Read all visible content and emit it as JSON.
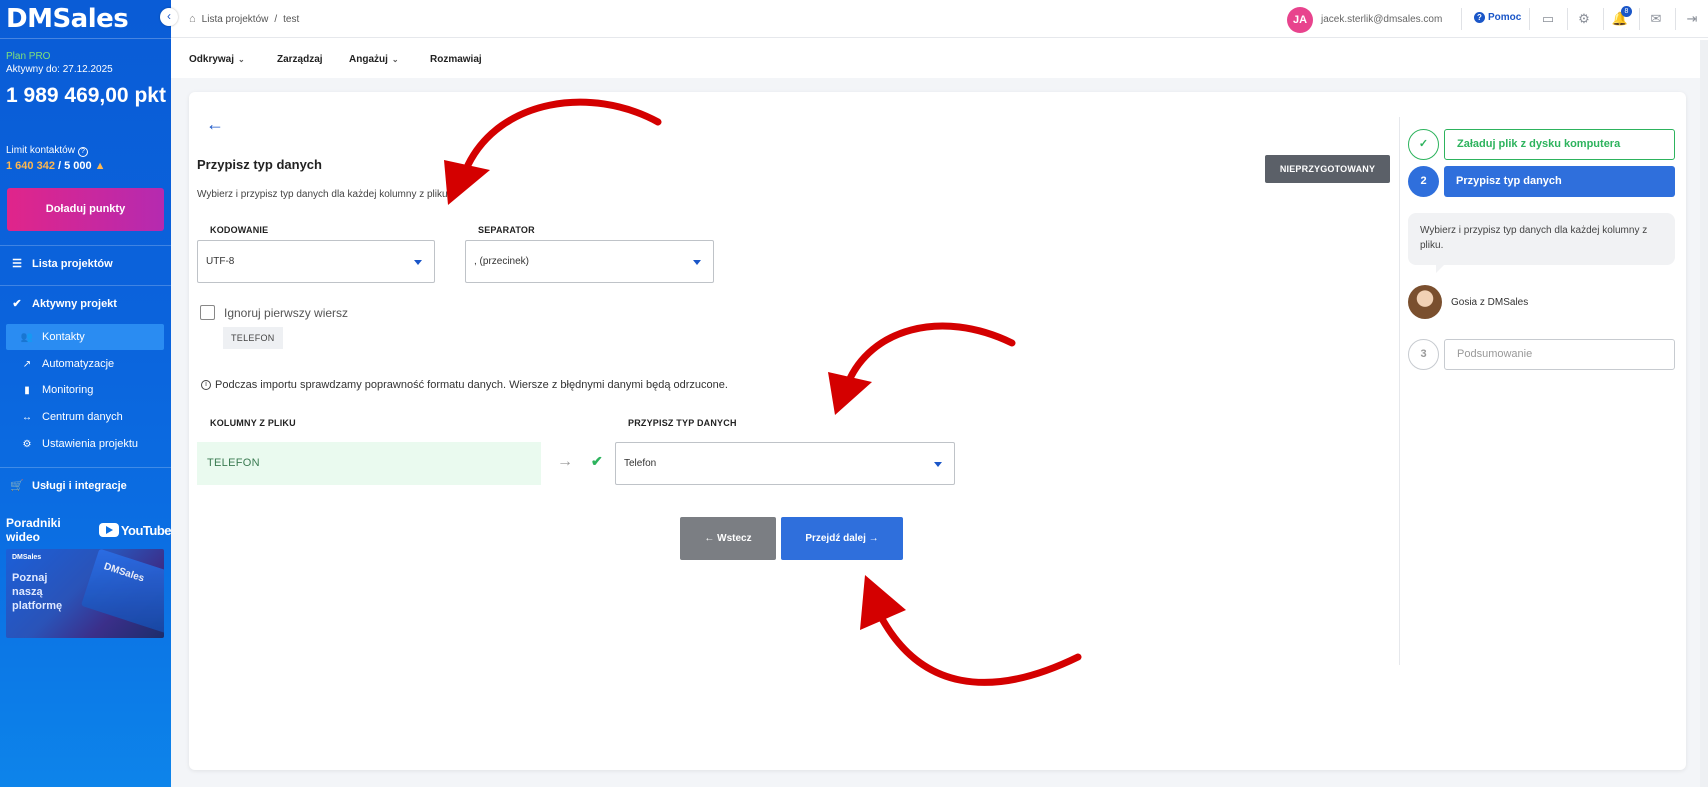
{
  "sidebar": {
    "logo": "DMSales",
    "collapse_icon": "chevron-left",
    "plan": "Plan PRO",
    "active_until": "Aktywny do: 27.12.2025",
    "points": "1 989 469,00 pkt",
    "limit_label": "Limit kontaktów",
    "limit_used": "1 640 342",
    "limit_total": " / 5 000",
    "topup_button": "Doładuj punkty",
    "items": [
      {
        "label": "Lista projektów",
        "icon": "list-icon"
      },
      {
        "label": "Aktywny projekt",
        "icon": "check-icon"
      },
      {
        "label": "Usługi i integracje",
        "icon": "cart-icon"
      }
    ],
    "subitems": [
      {
        "label": "Kontakty",
        "icon": "people-icon",
        "active": true
      },
      {
        "label": "Automatyzacje",
        "icon": "trend-icon"
      },
      {
        "label": "Monitoring",
        "icon": "bar-chart-icon"
      },
      {
        "label": "Centrum danych",
        "icon": "arrows-icon"
      },
      {
        "label": "Ustawienia projektu",
        "icon": "gear-icon"
      }
    ],
    "video_label": "Poradniki wideo",
    "youtube_label": "YouTube",
    "promo": {
      "logo": "DMSales",
      "text": "Poznaj naszą platformę"
    }
  },
  "topbar": {
    "breadcrumb": [
      "Lista projektów",
      "/",
      "test"
    ],
    "user_initials": "JA",
    "user_email": "jacek.sterlik@dmsales.com",
    "help_label": "Pomoc",
    "notification_count": "8"
  },
  "nav": {
    "items": [
      {
        "label": "Odkrywaj",
        "dropdown": true
      },
      {
        "label": "Zarządzaj",
        "dropdown": false
      },
      {
        "label": "Angażuj",
        "dropdown": true
      },
      {
        "label": "Rozmawiaj",
        "dropdown": false
      }
    ]
  },
  "main": {
    "title": "Przypisz typ danych",
    "subtitle": "Wybierz i przypisz typ danych dla każdej kolumny z pliku.",
    "status_badge": "NIEPRZYGOTOWANY",
    "encoding_label": "KODOWANIE",
    "encoding_value": "UTF-8",
    "separator_label": "SEPARATOR",
    "separator_value": ", (przecinek)",
    "ignore_first_row_label": "Ignoruj pierwszy wiersz",
    "ignore_first_row_checked": false,
    "first_row_tag": "TELEFON",
    "info_text": "Podczas importu sprawdzamy poprawność formatu danych. Wiersze z błędnymi danymi będą odrzucone.",
    "columns_header": "KOLUMNY Z PLIKU",
    "assign_header": "PRZYPISZ TYP DANYCH",
    "rows": [
      {
        "column": "TELEFON",
        "type": "Telefon"
      }
    ],
    "back_button": "← Wstecz",
    "next_button": "Przejdź dalej →"
  },
  "steps": {
    "items": [
      {
        "number": "✓",
        "label": "Załaduj plik z dysku komputera",
        "state": "done"
      },
      {
        "number": "2",
        "label": "Przypisz typ danych",
        "state": "active"
      },
      {
        "number": "3",
        "label": "Podsumowanie",
        "state": "pending"
      }
    ],
    "bubble_text": "Wybierz i przypisz typ danych dla każdej kolumny z pliku.",
    "assistant_name": "Gosia z DMSales"
  },
  "colors": {
    "sidebar": "#0b63dc",
    "accent": "#2f6fdc",
    "success": "#2db35d",
    "topup": "#e0258a",
    "annotation_arrow": "#d40000"
  }
}
